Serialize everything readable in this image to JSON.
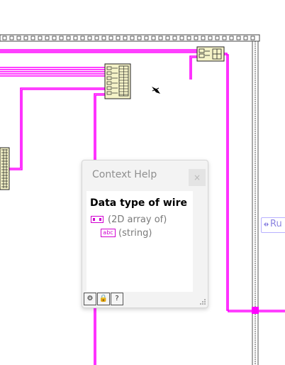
{
  "context_help": {
    "title": "Context Help",
    "close_glyph": "×",
    "heading": "Data type of wire",
    "items": [
      {
        "label": "(2D array of)",
        "icon": "2d-array-terminal-icon"
      },
      {
        "label": "(string)",
        "icon": "string-terminal-icon"
      }
    ],
    "string_icon_text": "abc",
    "toolbar": [
      {
        "icon": "simple-help-icon",
        "glyph": "⚙"
      },
      {
        "icon": "lock-icon",
        "glyph": "🔒"
      },
      {
        "icon": "detailed-help-icon",
        "glyph": "?"
      }
    ]
  },
  "diagram": {
    "wire_color": "#ff00ff",
    "node_fill": "#f5f3c8",
    "nodes": [
      {
        "name": "array-indicator-node"
      },
      {
        "name": "index-array-node"
      },
      {
        "name": "build-array-node"
      }
    ],
    "run_label_text": "Ru"
  }
}
